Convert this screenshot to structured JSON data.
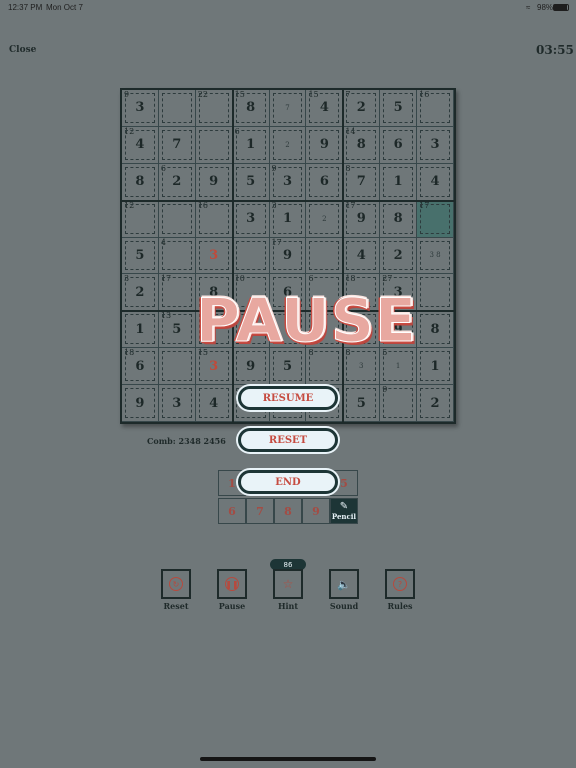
{
  "status_bar": {
    "time": "12:37 PM",
    "date": "Mon Oct 7",
    "battery": "98%"
  },
  "header": {
    "close_label": "Close",
    "timer": "03:55"
  },
  "grid": {
    "rows": [
      [
        {
          "v": "3",
          "c": "9"
        },
        {
          "v": ""
        },
        {
          "v": "",
          "c": "22"
        },
        {
          "v": "8",
          "c": "15"
        },
        {
          "v": "",
          "p": "7"
        },
        {
          "v": "4",
          "c": "15"
        },
        {
          "v": "2",
          "c": "7"
        },
        {
          "v": "5"
        },
        {
          "v": "",
          "c": "16"
        }
      ],
      [
        {
          "v": "4",
          "c": "12"
        },
        {
          "v": "7"
        },
        {
          "v": ""
        },
        {
          "v": "1",
          "c": "6"
        },
        {
          "v": "",
          "p": "2"
        },
        {
          "v": "9"
        },
        {
          "v": "8",
          "c": "14"
        },
        {
          "v": "6"
        },
        {
          "v": "3"
        }
      ],
      [
        {
          "v": "8"
        },
        {
          "v": "2",
          "c": "6"
        },
        {
          "v": "9"
        },
        {
          "v": "5"
        },
        {
          "v": "3",
          "c": "9"
        },
        {
          "v": "6"
        },
        {
          "v": "7",
          "c": "8"
        },
        {
          "v": "1"
        },
        {
          "v": "4"
        }
      ],
      [
        {
          "v": "",
          "c": "12"
        },
        {
          "v": ""
        },
        {
          "v": "",
          "c": "16"
        },
        {
          "v": "3"
        },
        {
          "v": "1",
          "c": "3"
        },
        {
          "v": "",
          "p": "2"
        },
        {
          "v": "9",
          "c": "17"
        },
        {
          "v": "8"
        },
        {
          "v": "",
          "c": "17",
          "sel": true
        }
      ],
      [
        {
          "v": "5"
        },
        {
          "v": "",
          "c": "4"
        },
        {
          "v": "3",
          "red": true
        },
        {
          "v": ""
        },
        {
          "v": "9",
          "c": "17"
        },
        {
          "v": ""
        },
        {
          "v": "4"
        },
        {
          "v": "2"
        },
        {
          "v": "",
          "p": "3 8"
        }
      ],
      [
        {
          "v": "2",
          "c": "3"
        },
        {
          "v": "",
          "c": "17"
        },
        {
          "v": "8"
        },
        {
          "v": "",
          "c": "10"
        },
        {
          "v": "6"
        },
        {
          "v": "",
          "c": "6"
        },
        {
          "v": "",
          "c": "18"
        },
        {
          "v": "3",
          "c": "27"
        },
        {
          "v": ""
        }
      ],
      [
        {
          "v": "1"
        },
        {
          "v": "5",
          "c": "13"
        },
        {
          "v": ""
        },
        {
          "v": ""
        },
        {
          "v": ""
        },
        {
          "v": ""
        },
        {
          "v": ""
        },
        {
          "v": "9"
        },
        {
          "v": "8"
        }
      ],
      [
        {
          "v": "6",
          "c": "18"
        },
        {
          "v": ""
        },
        {
          "v": "3",
          "c": "15",
          "red": true
        },
        {
          "v": "9"
        },
        {
          "v": "5"
        },
        {
          "v": "",
          "c": "8"
        },
        {
          "v": "",
          "c": "8",
          "p": "3"
        },
        {
          "v": "",
          "c": "5",
          "p": "1"
        },
        {
          "v": "1"
        }
      ],
      [
        {
          "v": "9"
        },
        {
          "v": "3"
        },
        {
          "v": "4"
        },
        {
          "v": ""
        },
        {
          "v": ""
        },
        {
          "v": ""
        },
        {
          "v": "5"
        },
        {
          "v": "",
          "c": "9"
        },
        {
          "v": "2"
        }
      ]
    ]
  },
  "comb_text": "Comb: 2348 2456",
  "pause": {
    "title": "PAUSE",
    "resume": "RESUME",
    "reset": "RESET",
    "end": "END"
  },
  "numpad": {
    "row1": [
      "1",
      "",
      "",
      "",
      "5"
    ],
    "row2": [
      "6",
      "7",
      "8",
      "9"
    ],
    "pencil": "Pencil"
  },
  "hint_count": "86",
  "toolbar": {
    "reset": "Reset",
    "pause": "Pause",
    "hint": "Hint",
    "sound": "Sound",
    "rules": "Rules"
  },
  "colors": {
    "background": "#6f7779",
    "accent_red": "#c64c41",
    "dark": "#1d2a2a",
    "selected": "#48706c"
  }
}
